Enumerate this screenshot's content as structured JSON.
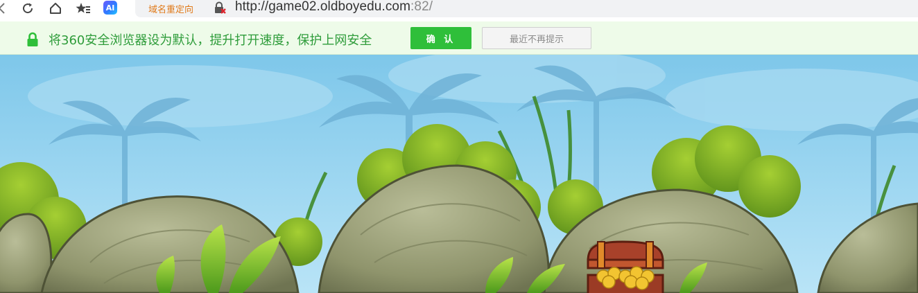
{
  "toolbar": {
    "icons": [
      "back-arrow-icon",
      "refresh-icon",
      "home-icon",
      "favorites-icon",
      "ai-icon"
    ],
    "ai_label": "AI",
    "redirect_label": "域名重定向",
    "url_main": "http://game02.oldboyedu.com",
    "url_port": ":82/"
  },
  "notification": {
    "message": "将360安全浏览器设为默认，提升打开速度，保护上网安全",
    "confirm_label": "确 认",
    "dismiss_label": "最近不再提示",
    "accent_color": "#2fbf3a"
  },
  "scene": {
    "description_elements": [
      "sky",
      "palm-silhouettes",
      "bushes",
      "boulders",
      "treasure-chest",
      "leaves"
    ]
  }
}
